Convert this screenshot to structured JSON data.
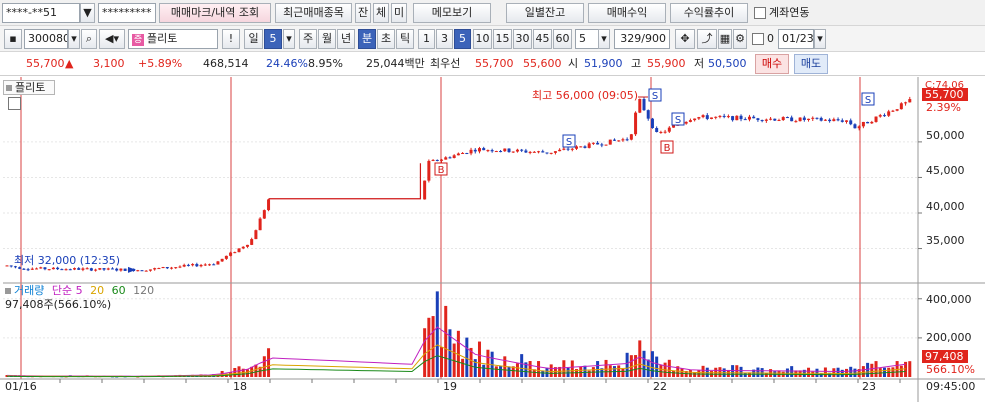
{
  "toolbar1": {
    "account": "****-**51",
    "password": "*********",
    "buttons": [
      "매매마크/내역 조회",
      "최근매매종목",
      "잔",
      "체",
      "미",
      "메모보기",
      "일별잔고",
      "매매수익",
      "수익률추이"
    ],
    "link_label": "계좌연동"
  },
  "toolbar2": {
    "code": "300080",
    "stock_name": "플리토",
    "period_buttons": [
      "일",
      "5",
      "주",
      "월",
      "년",
      "분",
      "초",
      "틱"
    ],
    "interval_buttons": [
      "1",
      "3",
      "5",
      "10",
      "15",
      "30",
      "45",
      "60",
      "5"
    ],
    "active_interval": "5",
    "count": "329",
    "count_total": "/900",
    "date": "01/23",
    "date_prefix": "0"
  },
  "quote": {
    "price": "55,700",
    "change_arrow": "▲",
    "change": "3,100",
    "change_pct": "+5.89%",
    "volume": "468,514",
    "volume_ratio": "24.46%",
    "turnover": "8.95%",
    "amount": "25,044백만",
    "best_label": "최우선",
    "ask": "55,700",
    "bid": "55,600",
    "open_label": "시",
    "open": "51,900",
    "high_label": "고",
    "high": "55,900",
    "low_label": "저",
    "low": "50,500",
    "buy_label": "매수",
    "sell_label": "매도"
  },
  "chart_panel": {
    "stock_label": "플리토",
    "max_label": "최고 56,000 (09:05)",
    "min_label": "최저 32,000 (12:35)",
    "price_axis_top": "C:74.06",
    "price_axis_values": [
      "50,000",
      "45,000",
      "40,000",
      "35,000"
    ],
    "current_price_tag": "55,700",
    "current_pct_tag": "2.39%",
    "volume_indicator_label": "거래량",
    "ma_label": "단순",
    "ma_periods": [
      "5",
      "20",
      "60",
      "120"
    ],
    "volume_value": "97,408주(566.10%)",
    "volume_axis_values": [
      "400,000",
      "200,000"
    ],
    "volume_tag": "97,408",
    "volume_pct_tag": "566.10%",
    "x_axis_labels": [
      "01/16",
      "18",
      "19",
      "22",
      "23"
    ],
    "time_label": "09:45:00"
  },
  "colors": {
    "up": "#e0241c",
    "down": "#1a3fb8",
    "accent_button": "#3c63b9"
  },
  "chart_data": {
    "type": "line",
    "title": "",
    "xlabel": "",
    "ylabel": "",
    "x": [
      "01/16",
      "01/16",
      "01/16",
      "01/18",
      "01/18",
      "01/18",
      "01/19",
      "01/19",
      "01/19",
      "01/19",
      "01/19",
      "01/22",
      "01/22",
      "01/22",
      "01/22",
      "01/23",
      "01/23"
    ],
    "series": [
      {
        "name": "",
        "values": [
          32600,
          32200,
          32000,
          32900,
          36000,
          42000,
          42000,
          47000,
          49000,
          48500,
          50500,
          56000,
          51000,
          53500,
          53000,
          52000,
          55700
        ]
      }
    ],
    "volume": [
      12000,
      8000,
      6000,
      15000,
      60000,
      140000,
      90000,
      420000,
      160000,
      60000,
      100000,
      150000,
      90000,
      50000,
      40000,
      45000,
      97408
    ],
    "ylim": [
      31000,
      58000
    ],
    "volume_ylim": [
      0,
      450000
    ],
    "markers": [
      {
        "label": "B",
        "x": "01/19"
      },
      {
        "label": "S",
        "x": "01/19"
      },
      {
        "label": "S",
        "x": "01/22"
      },
      {
        "label": "B",
        "x": "01/22"
      },
      {
        "label": "S",
        "x": "01/22"
      },
      {
        "label": "S",
        "x": "01/23"
      }
    ]
  }
}
